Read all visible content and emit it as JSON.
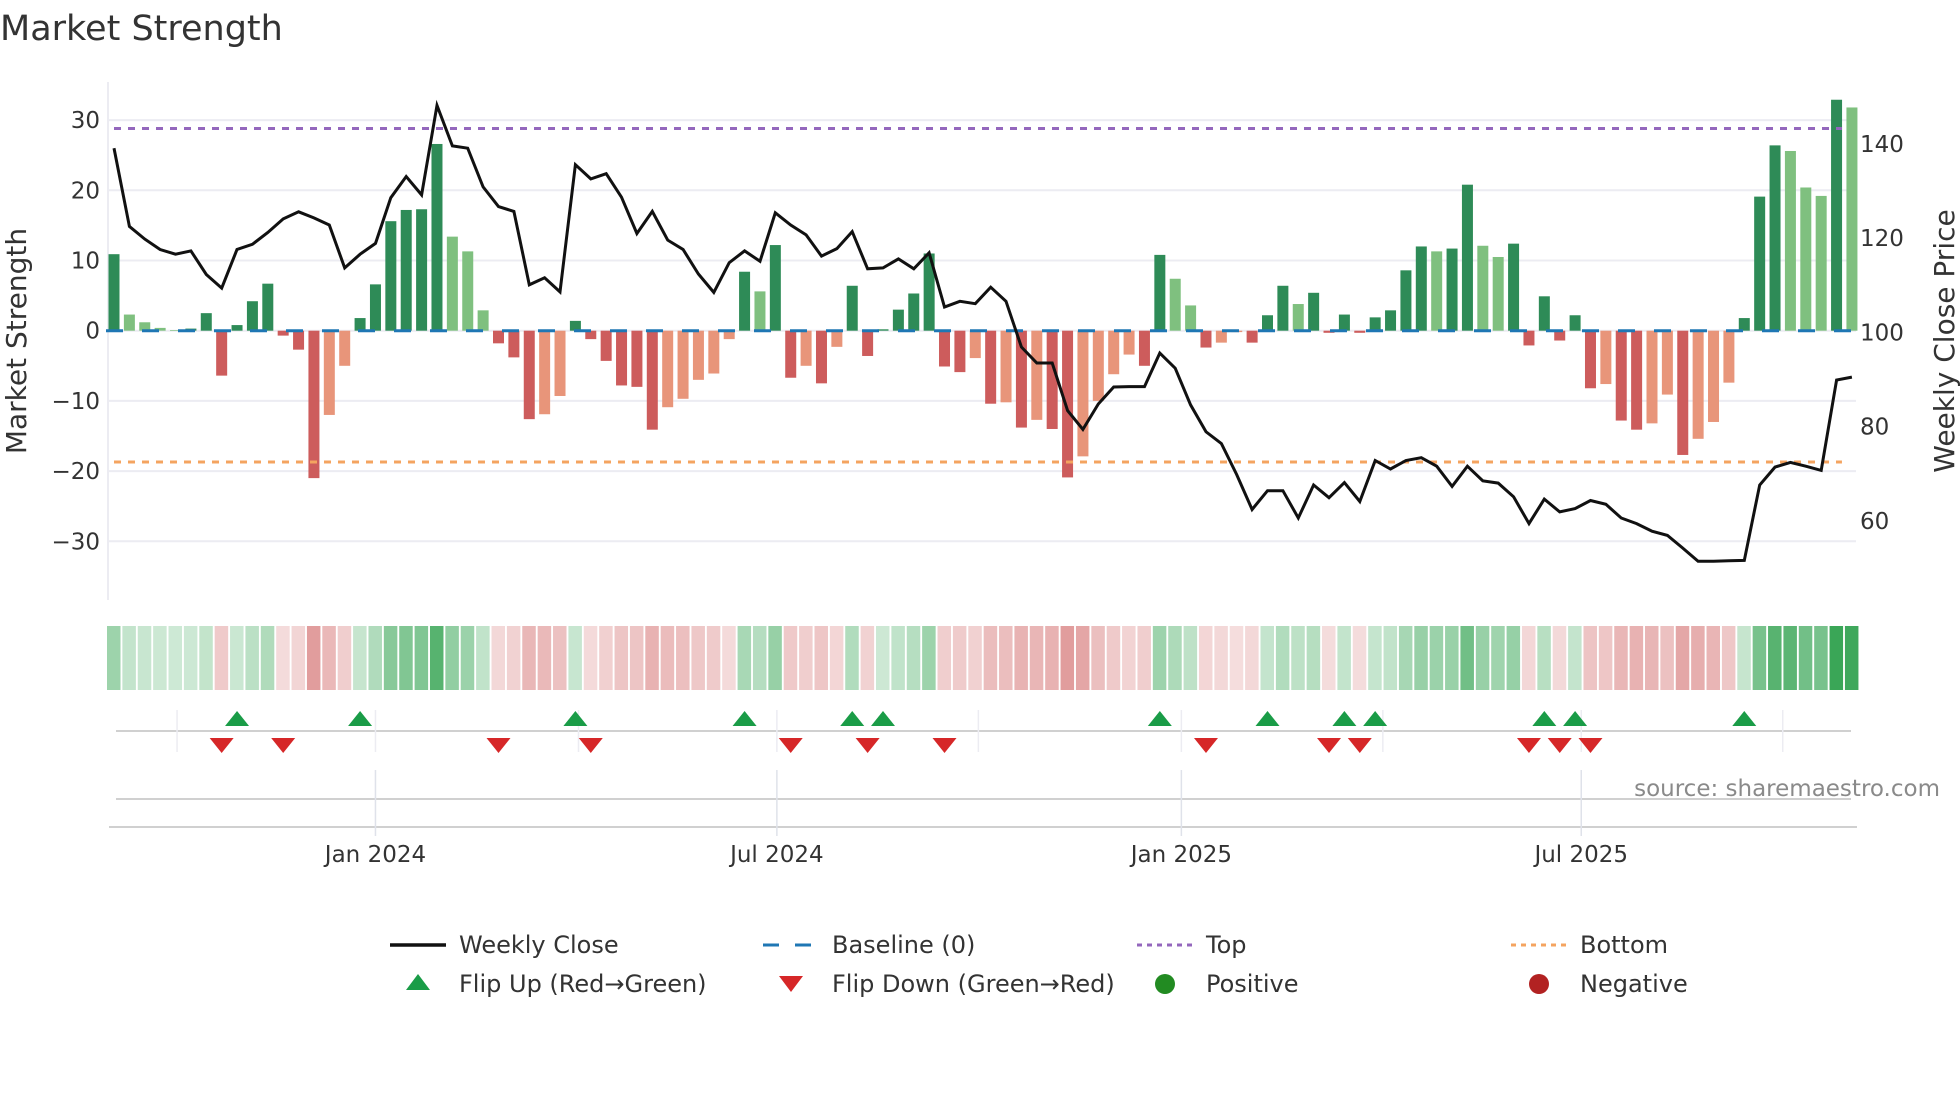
{
  "chart_data": {
    "type": "bar",
    "title": "Market Strength",
    "ylabel": "Market Strength",
    "y2label": "Weekly Close Price",
    "ylim": [
      -36,
      36
    ],
    "y2lim": [
      49,
      155
    ],
    "yticks": [
      -30,
      -20,
      -10,
      0,
      10,
      20,
      30
    ],
    "y2ticks": [
      60,
      80,
      100,
      120,
      140
    ],
    "x_ticks": [
      {
        "label": "Jan 2024",
        "week": 17
      },
      {
        "label": "Jul 2024",
        "week": 43.1
      },
      {
        "label": "Jan 2025",
        "week": 69.4
      },
      {
        "label": "Jul 2025",
        "week": 95.4
      }
    ],
    "top_level": 28.8,
    "bottom_level": -18.7,
    "baseline": 0,
    "strength": [
      10.9,
      2.3,
      1.2,
      0.4,
      0.1,
      0.3,
      2.5,
      -6.4,
      0.8,
      4.2,
      6.7,
      -0.7,
      -2.7,
      -21,
      -12,
      -5,
      1.8,
      6.6,
      15.6,
      17.2,
      17.3,
      26.6,
      13.4,
      11.3,
      2.9,
      -1.8,
      -3.8,
      -12.6,
      -11.9,
      -9.3,
      1.4,
      -1.2,
      -4.3,
      -7.8,
      -8,
      -14.1,
      -10.9,
      -9.7,
      -7,
      -6.1,
      -1.2,
      8.4,
      5.6,
      12.2,
      -6.7,
      -5,
      -7.5,
      -2.3,
      6.4,
      -3.6,
      0.2,
      3.0,
      5.3,
      11,
      -5.1,
      -5.9,
      -3.9,
      -10.4,
      -10.2,
      -13.8,
      -12.7,
      -14,
      -20.9,
      -17.9,
      -10,
      -6.2,
      -3.4,
      -5,
      10.8,
      7.4,
      3.6,
      -2.4,
      -1.7,
      -0.2,
      -1.7,
      2.2,
      6.4,
      3.8,
      5.4,
      -0.3,
      2.3,
      -0.3,
      1.9,
      2.9,
      8.6,
      12,
      11.3,
      11.7,
      20.8,
      12.1,
      10.5,
      12.4,
      -2.1,
      4.9,
      -1.4,
      2.2,
      -8.2,
      -7.6,
      -12.8,
      -14.1,
      -13.2,
      -9.1,
      -17.7,
      -15.4,
      -13,
      -7.4,
      1.8,
      19.1,
      26.4,
      25.6,
      20.4,
      19.2,
      32.9,
      31.8
    ],
    "weekly_close": [
      139.1,
      122.5,
      119.8,
      117.6,
      116.6,
      117.3,
      112.3,
      109.4,
      117.6,
      118.7,
      121.2,
      124.1,
      125.6,
      124.3,
      122.8,
      113.7,
      116.6,
      118.9,
      128.6,
      133.1,
      129.2,
      148.2,
      139.6,
      139.1,
      130.9,
      126.7,
      125.7,
      110.1,
      111.6,
      108.6,
      135.6,
      132.6,
      133.7,
      128.7,
      121,
      125.7,
      119.6,
      117.6,
      112.4,
      108.5,
      114.8,
      117.3,
      115.1,
      125.4,
      122.8,
      120.7,
      116.2,
      117.8,
      121.4,
      113.5,
      113.7,
      115.6,
      113.5,
      116.9,
      105.4,
      106.6,
      106.1,
      109.6,
      106.6,
      96.9,
      93.5,
      93.5,
      83.4,
      79.4,
      84.8,
      88.4,
      88.5,
      88.5,
      95.6,
      92.4,
      84.6,
      78.9,
      76.4,
      69.8,
      62.4,
      66.4,
      66.4,
      60.6,
      67.6,
      64.9,
      68.1,
      64.1,
      72.8,
      71,
      72.8,
      73.4,
      71.6,
      67.3,
      71.6,
      68.5,
      68,
      65.1,
      59.4,
      64.6,
      61.9,
      62.6,
      64.3,
      63.5,
      60.6,
      59.4,
      57.8,
      56.9,
      54.2,
      51.4,
      51.4,
      51.5,
      51.6,
      67.6,
      71.4,
      72.4,
      71.6,
      70.7,
      89.9,
      90.5
    ],
    "colors": {
      "positive_strong": "#2e8b57",
      "positive_weak": "#7fc07f",
      "negative_strong": "#cd5c5c",
      "negative_weak": "#e8957a",
      "baseline": "#1f77b4",
      "top": "#9467bd",
      "bottom": "#f4a460",
      "flip_up": "#1a9c47",
      "flip_down": "#d62728",
      "positive_dot": "#228b22",
      "negative_dot": "#b22222",
      "line": "#111111"
    },
    "legend": {
      "position": "bottom",
      "items": [
        {
          "label": "Weekly Close",
          "kind": "line"
        },
        {
          "label": "Baseline (0)",
          "kind": "baseline"
        },
        {
          "label": "Top",
          "kind": "top"
        },
        {
          "label": "Bottom",
          "kind": "bottom"
        },
        {
          "label": "Flip Up (Red→Green)",
          "kind": "up"
        },
        {
          "label": "Flip Down (Green→Red)",
          "kind": "down"
        },
        {
          "label": "Positive",
          "kind": "pos"
        },
        {
          "label": "Negative",
          "kind": "neg"
        }
      ]
    },
    "source": "source: sharemaestro.com"
  }
}
